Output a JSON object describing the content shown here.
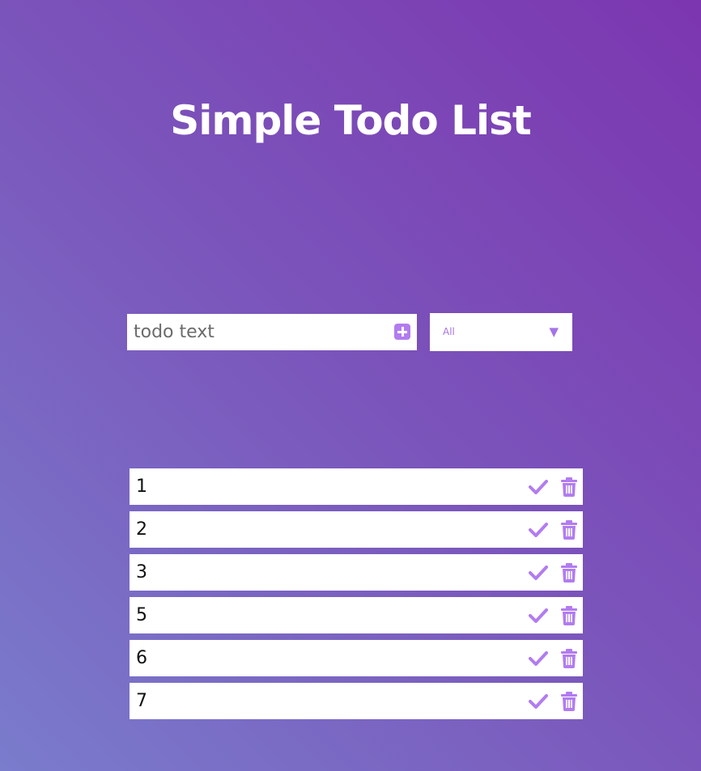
{
  "app": {
    "title": "Simple Todo List"
  },
  "input": {
    "placeholder": "todo text",
    "value": ""
  },
  "filter": {
    "selected": "All",
    "arrow": "▼"
  },
  "colors": {
    "accent": "#b27cf0",
    "gradient_start": "#7a7ccc",
    "gradient_end": "#7c36b0"
  },
  "icons": {
    "add": "plus-square-icon",
    "complete": "check-icon",
    "delete": "trash-icon"
  },
  "todos": [
    {
      "text": "1"
    },
    {
      "text": "2"
    },
    {
      "text": "3"
    },
    {
      "text": "5"
    },
    {
      "text": "6"
    },
    {
      "text": "7"
    }
  ]
}
